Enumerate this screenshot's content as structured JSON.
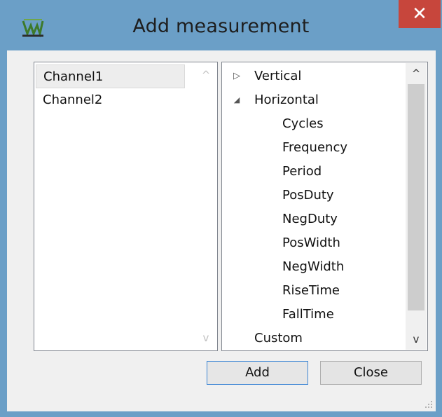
{
  "window": {
    "title": "Add measurement",
    "close_glyph": "✕",
    "icon": "app-logo-icon"
  },
  "channels": {
    "items": [
      {
        "label": "Channel1",
        "selected": true
      },
      {
        "label": "Channel2",
        "selected": false
      }
    ]
  },
  "tree": {
    "nodes": [
      {
        "label": "Vertical",
        "state": "collapsed",
        "level": 0
      },
      {
        "label": "Horizontal",
        "state": "expanded",
        "level": 0
      },
      {
        "label": "Cycles",
        "level": 1
      },
      {
        "label": "Frequency",
        "level": 1
      },
      {
        "label": "Period",
        "level": 1
      },
      {
        "label": "PosDuty",
        "level": 1
      },
      {
        "label": "NegDuty",
        "level": 1
      },
      {
        "label": "PosWidth",
        "level": 1
      },
      {
        "label": "NegWidth",
        "level": 1
      },
      {
        "label": "RiseTime",
        "level": 1
      },
      {
        "label": "FallTime",
        "level": 1
      },
      {
        "label": "Custom",
        "state": "none",
        "level": 0
      }
    ]
  },
  "buttons": {
    "add": "Add",
    "close": "Close"
  },
  "glyphs": {
    "collapsed": "▷",
    "expanded": "◢",
    "up": "^",
    "down": "v"
  },
  "colors": {
    "titlebar": "#6b9fc7",
    "close": "#c7463c",
    "default_button_border": "#3d86d4"
  }
}
